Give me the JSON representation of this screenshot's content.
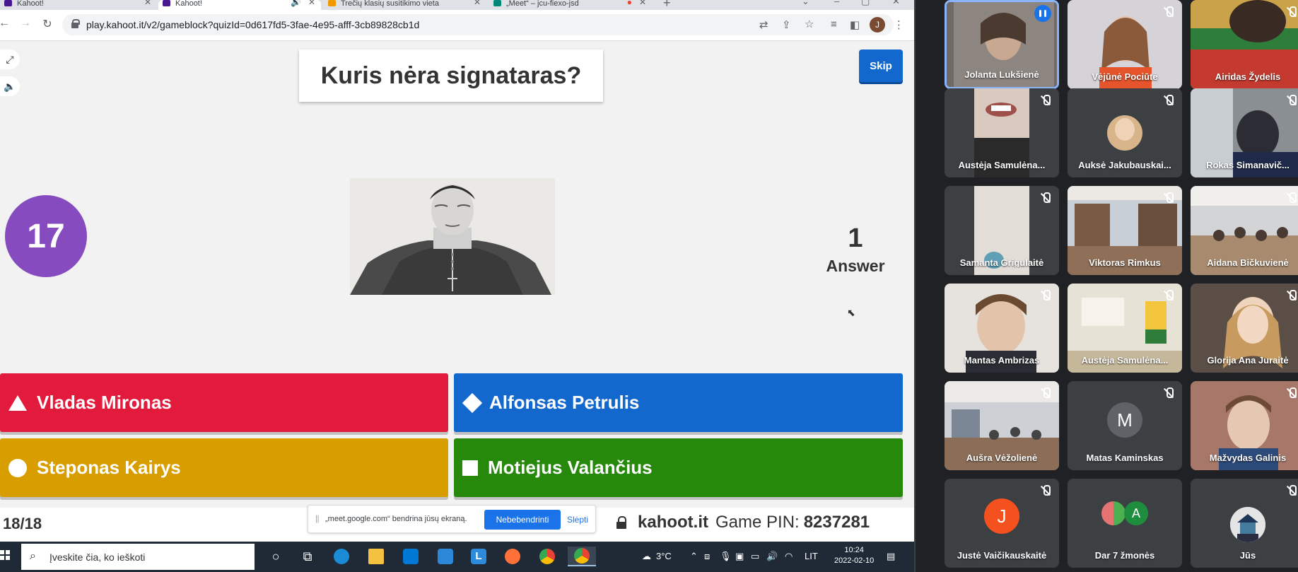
{
  "browser": {
    "tabs": [
      {
        "label": "Kahoot!"
      },
      {
        "label": "Kahoot!"
      },
      {
        "label": "Trečių klasių susitikimo vieta"
      },
      {
        "label": "„Meet“ – jcu-fiexo-jsd"
      }
    ],
    "url": "play.kahoot.it/v2/gameblock?quizId=0d617fd5-3fae-4e95-afff-3cb89828cb1d",
    "profile_initial": "J"
  },
  "kahoot": {
    "question": "Kuris nėra signataras?",
    "skip_label": "Skip",
    "timer": "17",
    "answer_count": "1",
    "answer_label": "Answer",
    "answers": [
      {
        "text": "Vladas Mironas",
        "color": "#e21b3c",
        "shape": "triangle"
      },
      {
        "text": "Alfonsas Petrulis",
        "color": "#1368ce",
        "shape": "diamond"
      },
      {
        "text": "Steponas Kairys",
        "color": "#d89e00",
        "shape": "circle"
      },
      {
        "text": "Motiejus Valančius",
        "color": "#26890c",
        "shape": "square"
      }
    ],
    "progress": "18/18",
    "brand": "kahoot.it",
    "pin_label": "Game PIN:",
    "pin": "8237281"
  },
  "share_bar": {
    "message": "„meet.google.com“ bendrina jūsų ekraną.",
    "stop_label": "Nebebendrinti",
    "hide_label": "Slėpti"
  },
  "taskbar": {
    "search_placeholder": "Įveskite čia, ko ieškoti",
    "weather": "3°C",
    "lang": "LIT",
    "time": "10:24",
    "date": "2022-02-10"
  },
  "meet": {
    "participants": [
      {
        "name": "Jolanta Lukšienė"
      },
      {
        "name": "Vėjūnė Pociūtė"
      },
      {
        "name": "Airidas Žydelis"
      },
      {
        "name": "Austėja Samulėna..."
      },
      {
        "name": "Auksė Jakubauskai..."
      },
      {
        "name": "Rokas Simanavič..."
      },
      {
        "name": "Samanta Grigulaitė"
      },
      {
        "name": "Viktoras Rimkus"
      },
      {
        "name": "Aidana Bičkuvienė"
      },
      {
        "name": "Mantas Ambrizas"
      },
      {
        "name": "Austėja Samulėna..."
      },
      {
        "name": "Glorija Ana Juraitė"
      },
      {
        "name": "Aušra Vėžolienė"
      },
      {
        "name": "Matas Kaminskas",
        "initial": "M"
      },
      {
        "name": "Mažvydas Galinis"
      },
      {
        "name": "Justė Vaičikauskaitė",
        "initial": "J"
      },
      {
        "name": "Dar 7 žmonės",
        "initial": "A"
      },
      {
        "name": "Jūs"
      }
    ]
  }
}
